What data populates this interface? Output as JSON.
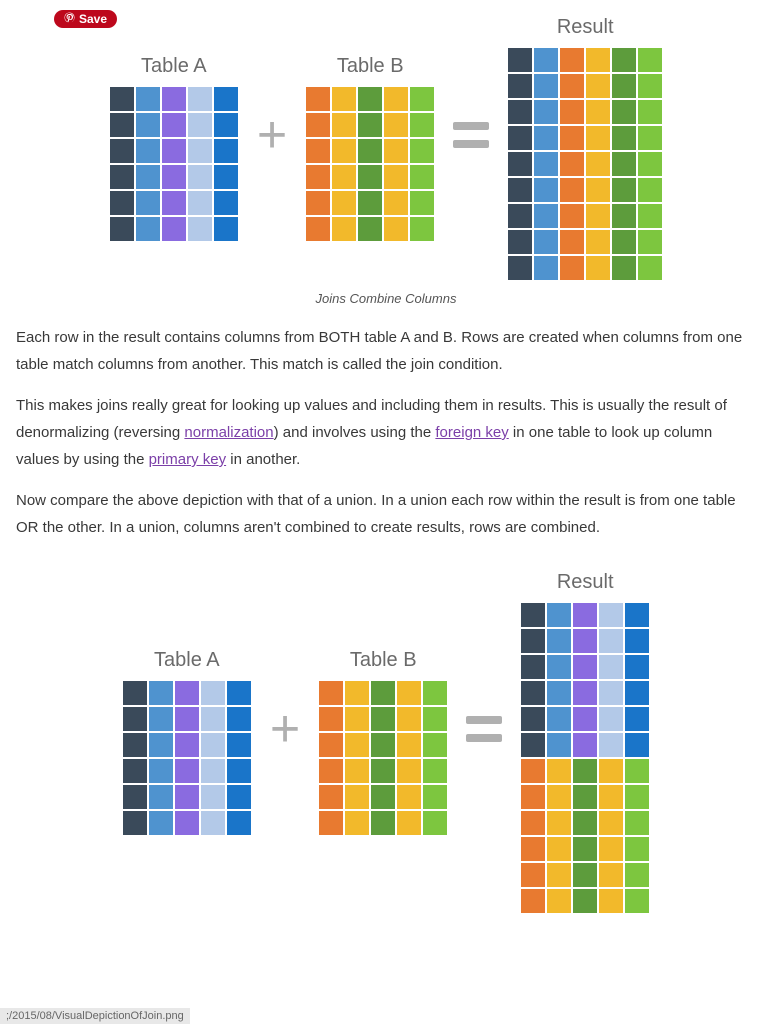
{
  "save_button": "Save",
  "diagram1": {
    "tableA_label": "Table A",
    "tableB_label": "Table B",
    "result_label": "Result",
    "caption": "Joins Combine Columns",
    "tableA_colors": [
      "#3a4a5a",
      "#4f93cf",
      "#8a6be0",
      "#b3c9e8",
      "#1a75c9"
    ],
    "tableA_rows": 6,
    "tableB_colors": [
      "#e87a30",
      "#f2b92b",
      "#5d9c3c",
      "#f2b92b",
      "#7dc63f"
    ],
    "tableB_rows": 6,
    "result_colors": [
      "#3a4a5a",
      "#4f93cf",
      "#e87a30",
      "#f2b92b",
      "#5d9c3c",
      "#7dc63f"
    ],
    "result_rows": 9
  },
  "para1_a": "Each row in the result contains columns from BOTH table A and B.  Rows are created when columns from one table match columns from another.  This match is called the join condition.",
  "para2_a": "This makes joins really great for looking up values and including them in results.  This is usually the result of denormalizing (reversing ",
  "link_normalization": "normalization",
  "para2_b": ") and involves using the ",
  "link_foreign": "foreign key",
  "para2_c": " in one table to look up column values by using the ",
  "link_primary": "primary key",
  "para2_d": " in another.",
  "para3": "Now compare the above depiction with that of a union.  In a union each row within the result is from one table OR the other.  In a union, columns aren't combined to create results, rows are combined.",
  "diagram2": {
    "tableA_label": "Table A",
    "tableB_label": "Table B",
    "result_label": "Result",
    "tableA_colors": [
      "#3a4a5a",
      "#4f93cf",
      "#8a6be0",
      "#b3c9e8",
      "#1a75c9"
    ],
    "tableA_rows": 6,
    "tableB_colors": [
      "#e87a30",
      "#f2b92b",
      "#5d9c3c",
      "#f2b92b",
      "#7dc63f"
    ],
    "tableB_rows": 6,
    "resultA_colors": [
      "#3a4a5a",
      "#4f93cf",
      "#8a6be0",
      "#b3c9e8",
      "#1a75c9"
    ],
    "resultA_rows": 6,
    "resultB_colors": [
      "#e87a30",
      "#f2b92b",
      "#5d9c3c",
      "#f2b92b",
      "#7dc63f"
    ],
    "resultB_rows": 6
  },
  "status_text": ";/2015/08/VisualDepictionOfJoin.png"
}
